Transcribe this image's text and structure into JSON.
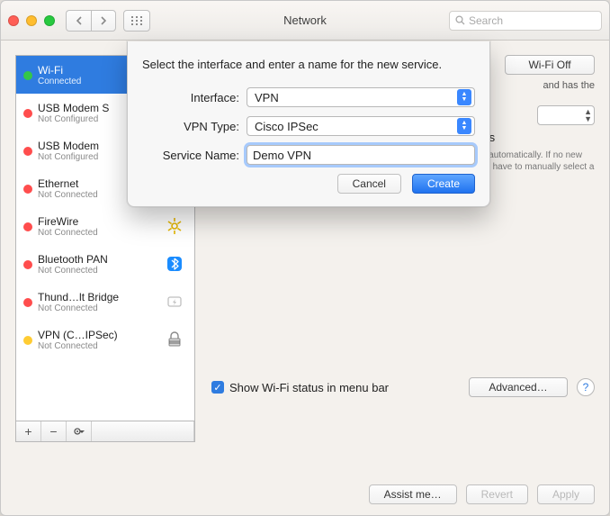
{
  "window": {
    "title": "Network"
  },
  "toolbar": {
    "search_placeholder": "Search"
  },
  "sidebar": {
    "items": [
      {
        "name": "Wi-Fi",
        "status": "Connected",
        "dot": "sd-green"
      },
      {
        "name": "USB Modem S",
        "status": "Not Configured",
        "dot": "sd-red"
      },
      {
        "name": "USB Modem",
        "status": "Not Configured",
        "dot": "sd-red"
      },
      {
        "name": "Ethernet",
        "status": "Not Connected",
        "dot": "sd-red"
      },
      {
        "name": "FireWire",
        "status": "Not Connected",
        "dot": "sd-red"
      },
      {
        "name": "Bluetooth PAN",
        "status": "Not Connected",
        "dot": "sd-red"
      },
      {
        "name": "Thund…lt Bridge",
        "status": "Not Connected",
        "dot": "sd-red"
      },
      {
        "name": "VPN (C…IPSec)",
        "status": "Not Connected",
        "dot": "sd-amber"
      }
    ],
    "add": "+",
    "remove": "−"
  },
  "content": {
    "wifi_toggle": "Wi-Fi Off",
    "status_fragment": "and has the",
    "ask_label": "Ask to join new networks",
    "ask_explain": "Known networks will be joined automatically. If no new networks are available, you will have to manually select a network.",
    "show_status": "Show Wi-Fi status in menu bar",
    "advanced": "Advanced…",
    "help": "?"
  },
  "footer": {
    "assist": "Assist me…",
    "revert": "Revert",
    "apply": "Apply"
  },
  "sheet": {
    "prompt": "Select the interface and enter a name for the new service.",
    "interface_label": "Interface:",
    "interface_value": "VPN",
    "vpntype_label": "VPN Type:",
    "vpntype_value": "Cisco IPSec",
    "servicename_label": "Service Name:",
    "servicename_value": "Demo VPN",
    "cancel": "Cancel",
    "create": "Create"
  }
}
